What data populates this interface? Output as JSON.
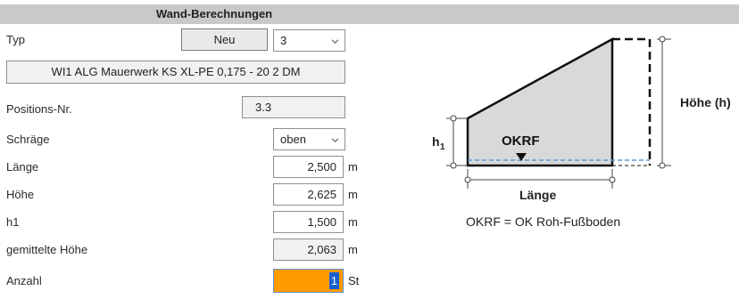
{
  "header": {
    "title": "Wand-Berechnungen"
  },
  "typ": {
    "label": "Typ",
    "button_label": "Neu",
    "select_value": "3"
  },
  "wall_description": "WI1 ALG Mauerwerk KS XL-PE 0,175 - 20 2 DM",
  "fields": [
    {
      "label": "Positions-Nr.",
      "value": "3.3",
      "unit": ""
    },
    {
      "label": "Schräge",
      "value": "oben",
      "unit": ""
    },
    {
      "label": "Länge",
      "value": "2,500",
      "unit": "m"
    },
    {
      "label": "Höhe",
      "value": "2,625",
      "unit": "m"
    },
    {
      "label": "h1",
      "value": "1,500",
      "unit": "m"
    },
    {
      "label": "gemittelte Höhe",
      "value": "2,063",
      "unit": "m"
    },
    {
      "label": "Anzahl",
      "value": "1",
      "unit": "St"
    }
  ],
  "diagram": {
    "label_height": "Höhe (h)",
    "label_h1_main": "h",
    "label_h1_sub": "1",
    "label_okrf": "OKRF",
    "label_length": "Länge",
    "legend": "OKRF = OK Roh-Fußboden"
  },
  "colors": {
    "header_bg": "#c9c9c9",
    "highlight": "#ff9a00",
    "wall_fill": "#d9d9d9",
    "floor_line": "#5a9ad6"
  }
}
